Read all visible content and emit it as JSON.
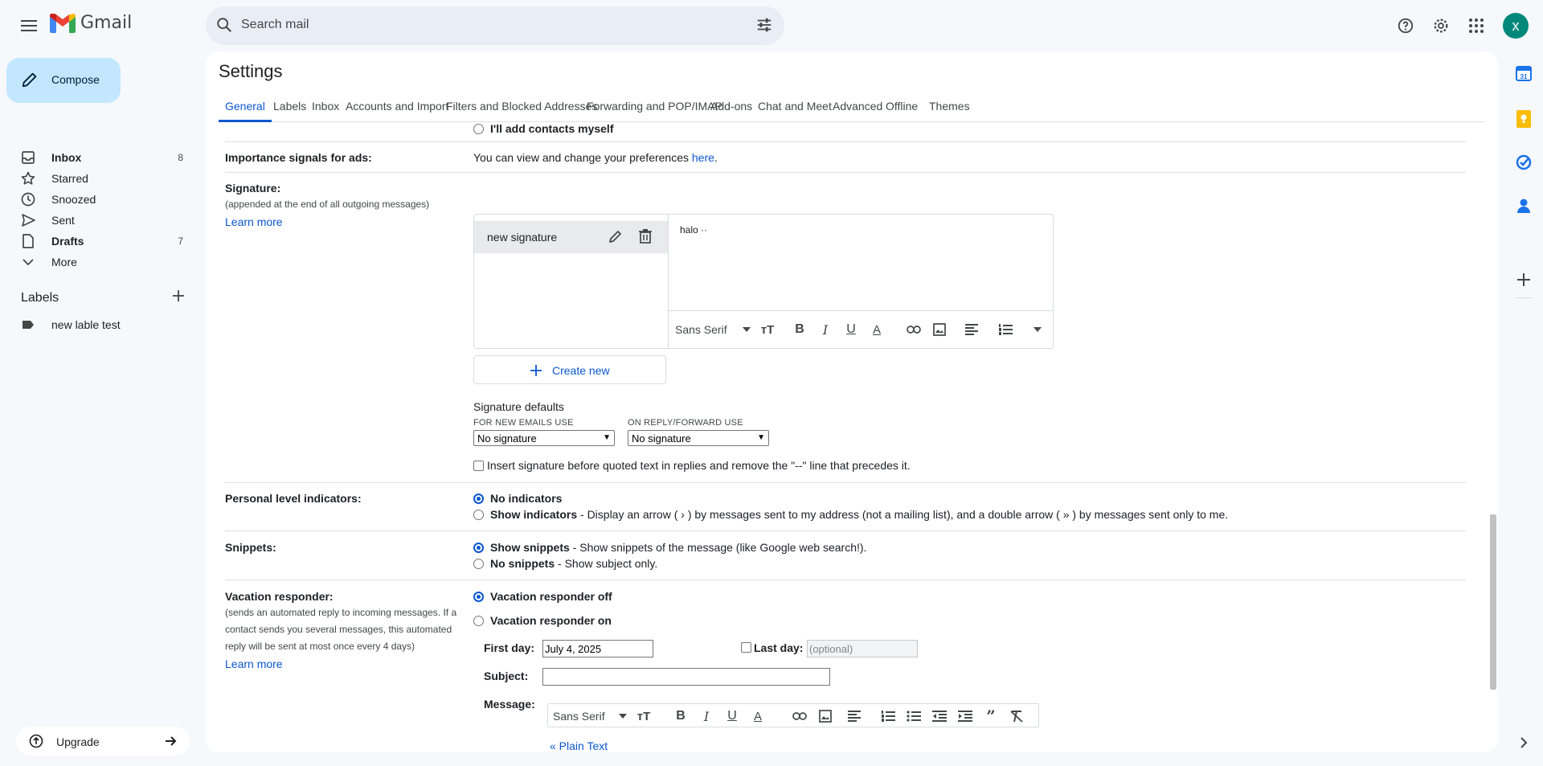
{
  "app": {
    "name": "Gmail"
  },
  "search": {
    "placeholder": "Search mail"
  },
  "account": {
    "initial": "x"
  },
  "compose": {
    "label": "Compose"
  },
  "nav": [
    {
      "label": "Inbox",
      "count": "8",
      "bold": true,
      "icon": "inbox-icon"
    },
    {
      "label": "Starred",
      "count": "",
      "bold": false,
      "icon": "star-icon"
    },
    {
      "label": "Snoozed",
      "count": "",
      "bold": false,
      "icon": "clock-icon"
    },
    {
      "label": "Sent",
      "count": "",
      "bold": false,
      "icon": "send-icon"
    },
    {
      "label": "Drafts",
      "count": "7",
      "bold": true,
      "icon": "draft-icon"
    },
    {
      "label": "More",
      "count": "",
      "bold": false,
      "icon": "chevron-down-icon"
    }
  ],
  "labels": {
    "heading": "Labels",
    "items": [
      {
        "label": "new lable test"
      }
    ]
  },
  "upgrade": {
    "label": "Upgrade"
  },
  "settings": {
    "title": "Settings",
    "tabs": [
      "General",
      "Labels",
      "Inbox",
      "Accounts and Import",
      "Filters and Blocked Addresses",
      "Forwarding and POP/IMAP",
      "Add-ons",
      "Chat and Meet",
      "Advanced",
      "Offline",
      "Themes"
    ],
    "active_tab": "General"
  },
  "contacts": {
    "manual_option": "I'll add contacts myself"
  },
  "importance": {
    "label": "Importance signals for ads:",
    "text": "You can view and change your preferences ",
    "link": "here",
    "suffix": "."
  },
  "signature": {
    "label": "Signature:",
    "sublabel": "(appended at the end of all outgoing messages)",
    "learn_more": "Learn more",
    "items": [
      {
        "name": "new signature"
      }
    ],
    "editor_text": "halo",
    "editor_font": "Sans Serif",
    "create_new": "Create new",
    "defaults_title": "Signature defaults",
    "new_emails_label": "FOR NEW EMAILS USE",
    "new_emails_value": "No signature",
    "reply_label": "ON REPLY/FORWARD USE",
    "reply_value": "No signature",
    "insert_before_quoted": "Insert signature before quoted text in replies and remove the \"--\" line that precedes it."
  },
  "personal_indicators": {
    "label": "Personal level indicators:",
    "options": [
      {
        "title": "No indicators",
        "desc": "",
        "selected": true
      },
      {
        "title": "Show indicators",
        "desc": " - Display an arrow ( › ) by messages sent to my address (not a mailing list), and a double arrow ( » ) by messages sent only to me.",
        "selected": false
      }
    ]
  },
  "snippets": {
    "label": "Snippets:",
    "options": [
      {
        "title": "Show snippets",
        "desc": " - Show snippets of the message (like Google web search!).",
        "selected": true
      },
      {
        "title": "No snippets",
        "desc": " - Show subject only.",
        "selected": false
      }
    ]
  },
  "vacation": {
    "label": "Vacation responder:",
    "sublabel": "(sends an automated reply to incoming messages. If a contact sends you several messages, this automated reply will be sent at most once every 4 days)",
    "learn_more": "Learn more",
    "off_label": "Vacation responder off",
    "on_label": "Vacation responder on",
    "first_day_label": "First day:",
    "first_day_value": "July 4, 2025",
    "last_day_label": "Last day:",
    "last_day_placeholder": "(optional)",
    "subject_label": "Subject:",
    "message_label": "Message:",
    "editor_font": "Sans Serif",
    "plain_text": "« Plain Text"
  },
  "colors": {
    "accent": "#0b57d0",
    "compose_bg": "#c2e7ff",
    "page_bg": "#f6f8fc"
  }
}
